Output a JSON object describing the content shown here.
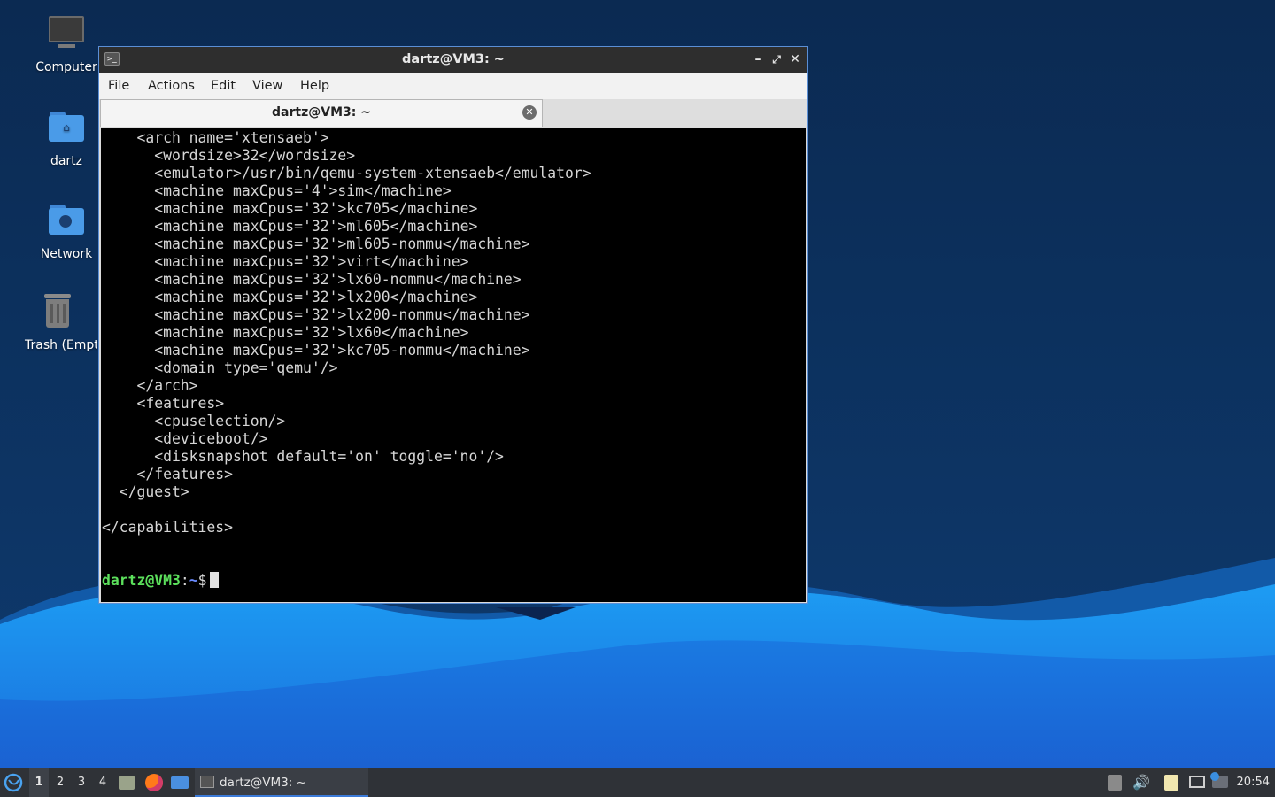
{
  "desktop": {
    "icons": [
      {
        "label": "Computer",
        "icon": "computer-icon"
      },
      {
        "label": "dartz",
        "icon": "home-folder-icon"
      },
      {
        "label": "Network",
        "icon": "network-folder-icon"
      },
      {
        "label": "Trash (Empt",
        "icon": "trash-icon"
      }
    ]
  },
  "window": {
    "title": "dartz@VM3: ~",
    "menu": [
      "File",
      "Actions",
      "Edit",
      "View",
      "Help"
    ],
    "tab_label": "dartz@VM3: ~",
    "terminal_lines": [
      "    <arch name='xtensaeb'>",
      "      <wordsize>32</wordsize>",
      "      <emulator>/usr/bin/qemu-system-xtensaeb</emulator>",
      "      <machine maxCpus='4'>sim</machine>",
      "      <machine maxCpus='32'>kc705</machine>",
      "      <machine maxCpus='32'>ml605</machine>",
      "      <machine maxCpus='32'>ml605-nommu</machine>",
      "      <machine maxCpus='32'>virt</machine>",
      "      <machine maxCpus='32'>lx60-nommu</machine>",
      "      <machine maxCpus='32'>lx200</machine>",
      "      <machine maxCpus='32'>lx200-nommu</machine>",
      "      <machine maxCpus='32'>lx60</machine>",
      "      <machine maxCpus='32'>kc705-nommu</machine>",
      "      <domain type='qemu'/>",
      "    </arch>",
      "    <features>",
      "      <cpuselection/>",
      "      <deviceboot/>",
      "      <disksnapshot default='on' toggle='no'/>",
      "    </features>",
      "  </guest>",
      "",
      "</capabilities>"
    ],
    "prompt": {
      "user_host": "dartz@VM3",
      "colon": ":",
      "path": "~",
      "symbol": "$"
    }
  },
  "taskbar": {
    "workspaces": [
      "1",
      "2",
      "3",
      "4"
    ],
    "active_workspace": "1",
    "launchers": [
      "file-manager-icon",
      "firefox-icon",
      "show-desktop-icon"
    ],
    "task_label": "dartz@VM3: ~",
    "tray": [
      "update-notifier-icon",
      "volume-icon",
      "clipboard-icon",
      "network-icon",
      "notification-icon"
    ],
    "clock": "20:54"
  },
  "colors": {
    "desktop_dark": "#0d2a52",
    "wave_light": "#1f8ff0",
    "window_border": "#5b8fd6",
    "prompt_user": "#5ce05c",
    "prompt_path": "#6a8bff",
    "taskbar": "#2f3237"
  }
}
